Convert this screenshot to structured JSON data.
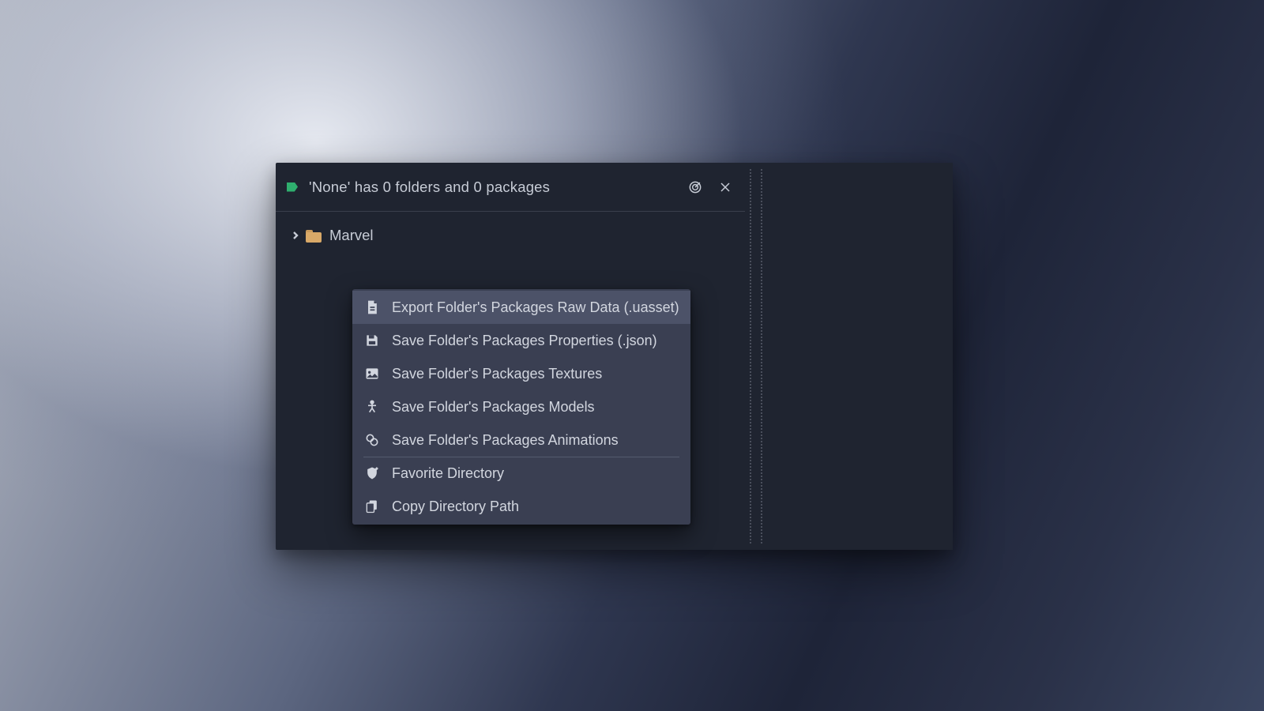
{
  "header": {
    "status": "'None' has 0 folders and 0 packages"
  },
  "tree": {
    "root": {
      "label": "Marvel"
    }
  },
  "menu": {
    "export_raw": "Export Folder's Packages Raw Data (.uasset)",
    "save_json": "Save Folder's Packages Properties (.json)",
    "save_textures": "Save Folder's Packages Textures",
    "save_models": "Save Folder's Packages Models",
    "save_animations": "Save Folder's Packages Animations",
    "favorite": "Favorite Directory",
    "copy_path": "Copy Directory Path"
  }
}
